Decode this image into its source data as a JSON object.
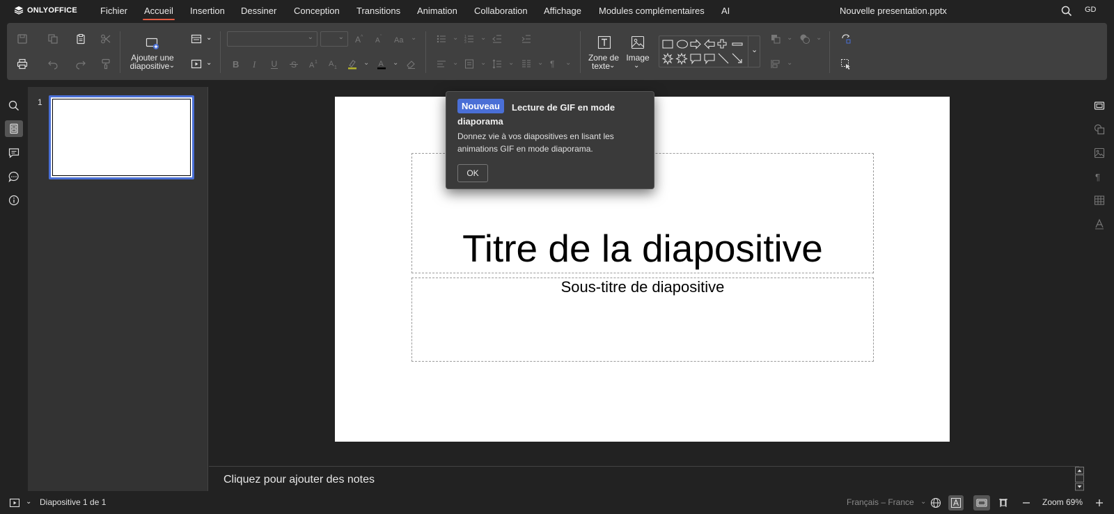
{
  "app": {
    "logo_text": "ONLYOFFICE",
    "document_title": "Nouvelle presentation.pptx",
    "user_initials": "GD",
    "accent_color": "#4a6fd6",
    "active_tab_underline_color": "#e25c43"
  },
  "menu": {
    "tabs": [
      {
        "label": "Fichier"
      },
      {
        "label": "Accueil",
        "active": true
      },
      {
        "label": "Insertion"
      },
      {
        "label": "Dessiner"
      },
      {
        "label": "Conception"
      },
      {
        "label": "Transitions"
      },
      {
        "label": "Animation"
      },
      {
        "label": "Collaboration"
      },
      {
        "label": "Affichage"
      },
      {
        "label": "Modules complémentaires"
      },
      {
        "label": "AI"
      }
    ]
  },
  "ribbon": {
    "add_slide_label_line1": "Ajouter une",
    "add_slide_label_line2": "diapositive",
    "text_box_label_line1": "Zone de",
    "text_box_label_line2": "texte",
    "image_label": "Image",
    "font_name_value": "",
    "font_size_value": ""
  },
  "slides_panel": {
    "slides": [
      {
        "number": "1",
        "selected": true
      }
    ]
  },
  "slide": {
    "title": "Titre de la diapositive",
    "subtitle": "Sous-titre de diapositive"
  },
  "popover": {
    "badge": "Nouveau",
    "title": "Lecture de GIF en mode diaporama",
    "body": "Donnez vie à vos diapositives en lisant les animations GIF en mode diaporama.",
    "ok_label": "OK"
  },
  "notes": {
    "placeholder": "Cliquez pour ajouter des notes"
  },
  "status": {
    "slide_counter": "Diapositive 1 de 1",
    "language": "Français – France",
    "zoom_label": "Zoom 69%"
  }
}
